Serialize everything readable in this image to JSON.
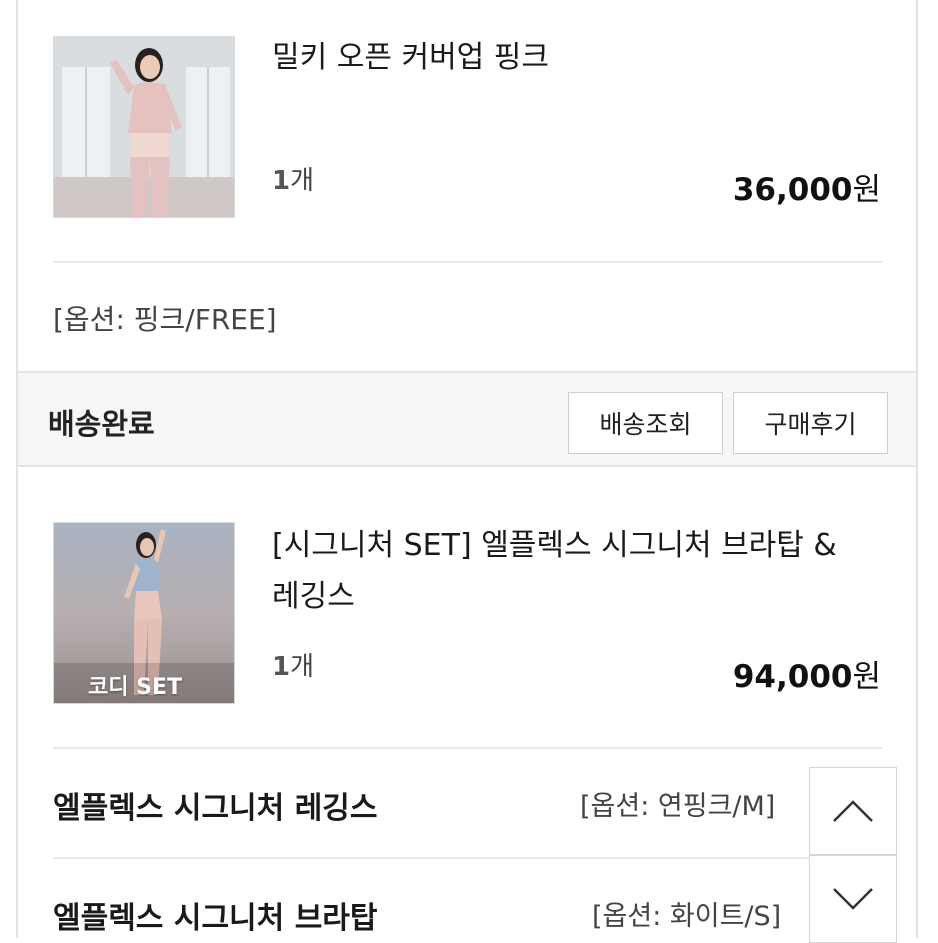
{
  "orders": [
    {
      "product_name": "밀키 오픈 커버업 핑크",
      "quantity_number": "1",
      "quantity_unit": "개",
      "price_number": "36,000",
      "price_unit": "원",
      "option": "[옵션: 핑크/FREE]"
    },
    {
      "product_name_line1": "[시그니처 SET] 엘플렉스 시그니처 브라탑 &",
      "product_name_line2": "레깅스",
      "thumbnail_label": "코디 SET",
      "quantity_number": "1",
      "quantity_unit": "개",
      "price_number": "94,000",
      "price_unit": "원",
      "sub_items": [
        {
          "name": "엘플렉스 시그니처 레깅스",
          "option": "[옵션: 연핑크/M]"
        },
        {
          "name": "엘플렉스 시그니처 브라탑",
          "option": "[옵션: 화이트/S]"
        }
      ]
    }
  ],
  "status": {
    "label": "배송완료",
    "track_button": "배송조회",
    "review_button": "구매후기"
  },
  "icons": {
    "scroll_up": "chevron-up-icon",
    "scroll_down": "chevron-down-icon"
  },
  "colors": {
    "border": "#e3e3e3",
    "status_bg": "#f6f6f6",
    "text": "#222222"
  }
}
